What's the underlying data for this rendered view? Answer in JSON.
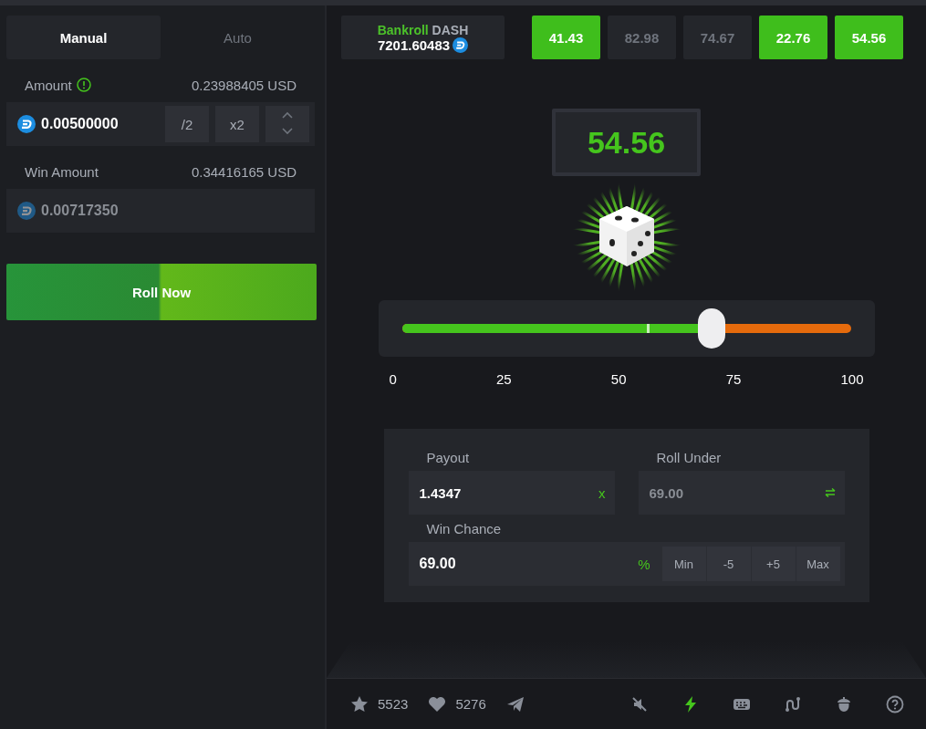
{
  "mode_tabs": [
    {
      "label": "Manual",
      "selected": true
    },
    {
      "label": "Auto",
      "selected": false
    }
  ],
  "amount": {
    "label": "Amount",
    "usd": "0.23988405 USD",
    "value": "0.00500000",
    "buttons": [
      "/2",
      "x2"
    ]
  },
  "win_amount": {
    "label": "Win Amount",
    "usd": "0.34416165 USD",
    "value": "0.00717350"
  },
  "roll_button": "Roll Now",
  "bankroll": {
    "label": "Bankroll",
    "currency": "DASH",
    "value": "7201.60483"
  },
  "recent_results": [
    {
      "value": "41.43",
      "win": true
    },
    {
      "value": "82.98",
      "win": false
    },
    {
      "value": "74.67",
      "win": false
    },
    {
      "value": "22.76",
      "win": true
    },
    {
      "value": "54.56",
      "win": true
    }
  ],
  "result": "54.56",
  "slider": {
    "level": 0.69,
    "result_marker": {
      "level": 0.5456
    },
    "ticks": [
      "0",
      "25",
      "50",
      "75",
      "100"
    ]
  },
  "payout": {
    "label": "Payout",
    "value": "1.4347",
    "suffix": "x"
  },
  "roll_under": {
    "label": "Roll Under",
    "value": "69.00"
  },
  "win_chance": {
    "label": "Win Chance",
    "value": "69.00",
    "suffix": "%",
    "buttons": [
      "Min",
      "-5",
      "+5",
      "Max"
    ]
  },
  "footer": {
    "stars": "5523",
    "likes": "5276",
    "tools": [
      {
        "kind": "mute",
        "on": false
      },
      {
        "kind": "bolt",
        "on": true
      },
      {
        "kind": "keyboard",
        "on": false
      },
      {
        "kind": "curve",
        "on": false
      },
      {
        "kind": "acorn",
        "on": false
      },
      {
        "kind": "help",
        "on": false
      }
    ]
  }
}
